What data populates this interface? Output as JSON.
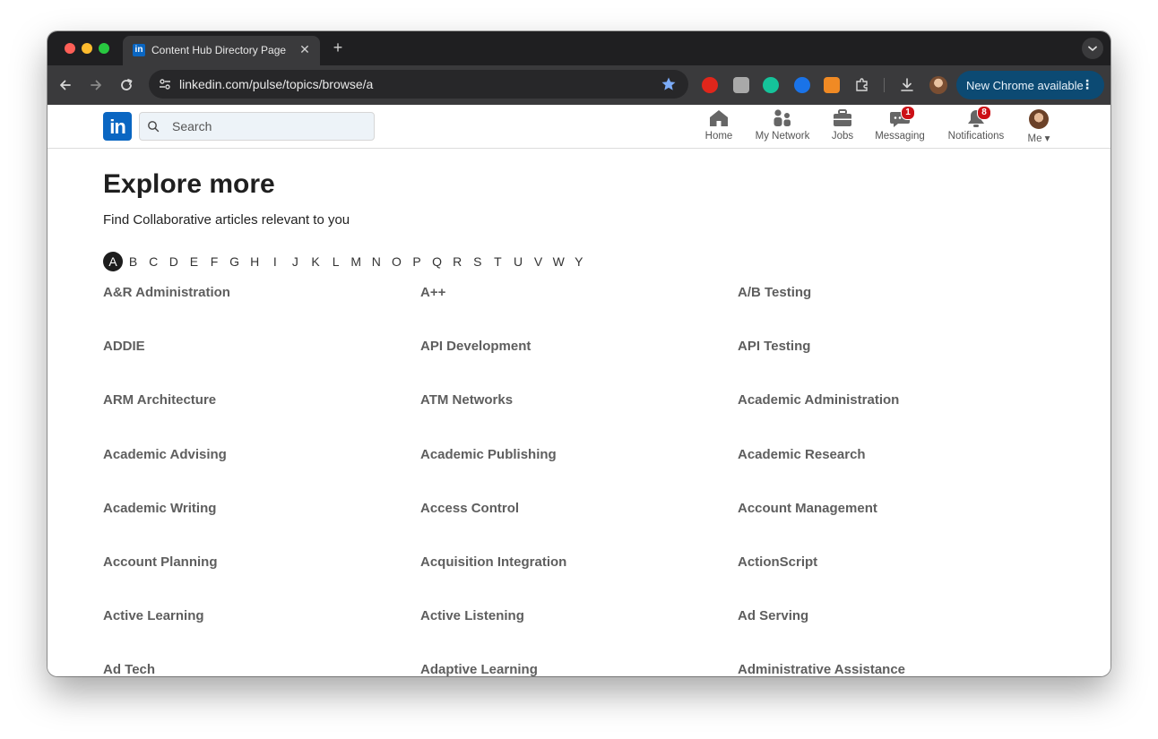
{
  "browser": {
    "tab_title": "Content Hub Directory Page",
    "tab_close": "✕",
    "new_tab": "+",
    "url": "linkedin.com/pulse/topics/browse/a",
    "update_label": "New Chrome available",
    "update_menu": "⋮"
  },
  "linkedin": {
    "logo": "in",
    "search_placeholder": "Search",
    "nav": [
      {
        "label": "Home",
        "icon": "home-icon"
      },
      {
        "label": "My Network",
        "icon": "my-network-icon"
      },
      {
        "label": "Jobs",
        "icon": "jobs-icon"
      },
      {
        "label": "Messaging",
        "icon": "messaging-icon",
        "badge": "1"
      },
      {
        "label": "Notifications",
        "icon": "notifications-icon",
        "badge": "8"
      },
      {
        "label": "Me ▾",
        "icon": "avatar"
      }
    ],
    "brand_color": "#0a66c2",
    "badge_color": "#cc1016"
  },
  "page": {
    "heading": "Explore more",
    "subheading": "Find Collaborative articles relevant to you",
    "letters": [
      "A",
      "B",
      "C",
      "D",
      "E",
      "F",
      "G",
      "H",
      "I",
      "J",
      "K",
      "L",
      "M",
      "N",
      "O",
      "P",
      "Q",
      "R",
      "S",
      "T",
      "U",
      "V",
      "W",
      "Y"
    ],
    "active_letter": "A",
    "topics": [
      "A&R Administration",
      "A++",
      "A/B Testing",
      "ADDIE",
      "API Development",
      "API Testing",
      "ARM Architecture",
      "ATM Networks",
      "Academic Administration",
      "Academic Advising",
      "Academic Publishing",
      "Academic Research",
      "Academic Writing",
      "Access Control",
      "Account Management",
      "Account Planning",
      "Acquisition Integration",
      "ActionScript",
      "Active Learning",
      "Active Listening",
      "Ad Serving",
      "Ad Tech",
      "Adaptive Learning",
      "Administrative Assistance"
    ]
  }
}
